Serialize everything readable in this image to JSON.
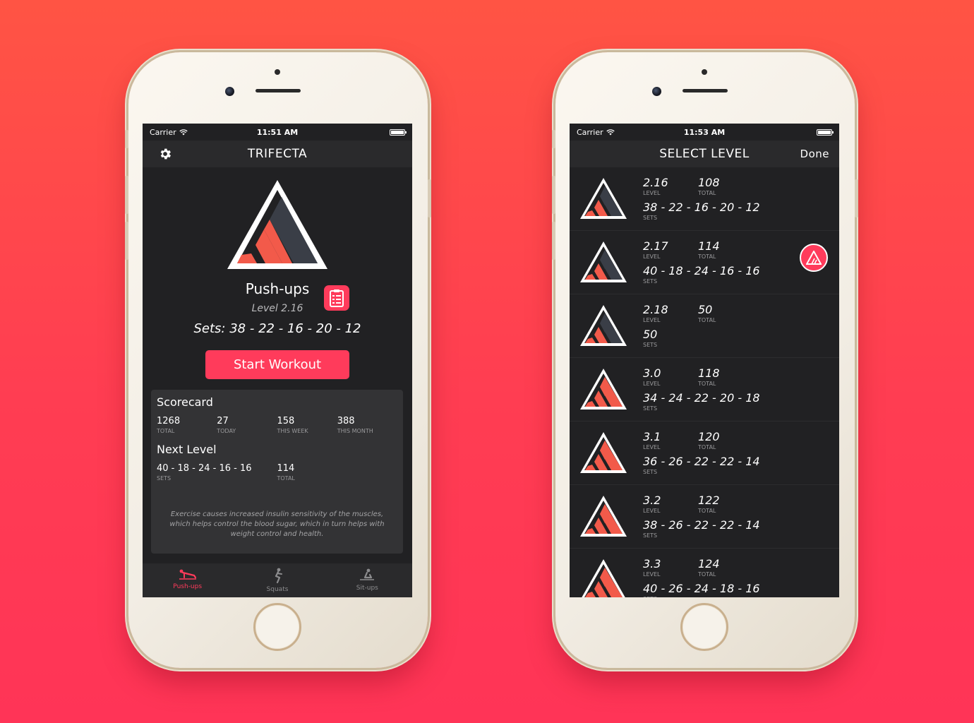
{
  "left": {
    "status": {
      "carrier": "Carrier",
      "time": "11:51 AM"
    },
    "nav": {
      "title": "TRIFECTA"
    },
    "exercise": {
      "name": "Push-ups",
      "level": "Level 2.16",
      "sets": "Sets: 38 - 22 - 16 - 20 - 12",
      "start_label": "Start Workout"
    },
    "scorecard": {
      "title": "Scorecard",
      "stats": [
        {
          "value": "1268",
          "label": "TOTAL"
        },
        {
          "value": "27",
          "label": "TODAY"
        },
        {
          "value": "158",
          "label": "THIS WEEK"
        },
        {
          "value": "388",
          "label": "THIS MONTH"
        }
      ]
    },
    "next_level": {
      "title": "Next Level",
      "sets_value": "40 - 18 - 24 - 16 - 16",
      "sets_label": "SETS",
      "total_value": "114",
      "total_label": "TOTAL"
    },
    "quote": "Exercise causes increased insulin sensitivity of the muscles, which helps control the blood sugar, which in turn helps with weight control and health.",
    "tabs": [
      {
        "label": "Push-ups",
        "icon": "pushup-icon",
        "active": true
      },
      {
        "label": "Squats",
        "icon": "squat-icon",
        "active": false
      },
      {
        "label": "Sit-ups",
        "icon": "situp-icon",
        "active": false
      }
    ]
  },
  "right": {
    "status": {
      "carrier": "Carrier",
      "time": "11:53 AM"
    },
    "nav": {
      "title": "SELECT LEVEL",
      "done_label": "Done"
    },
    "labels": {
      "level": "LEVEL",
      "total": "TOTAL",
      "sets": "SETS"
    },
    "levels": [
      {
        "level": "2.16",
        "total": "108",
        "sets": "38 - 22 - 16 - 20 - 12",
        "current": false
      },
      {
        "level": "2.17",
        "total": "114",
        "sets": "40 - 18 - 24 - 16 - 16",
        "current": true
      },
      {
        "level": "2.18",
        "total": "50",
        "sets": "50",
        "current": false
      },
      {
        "level": "3.0",
        "total": "118",
        "sets": "34 - 24 - 22 - 20 - 18",
        "current": false
      },
      {
        "level": "3.1",
        "total": "120",
        "sets": "36 - 26 - 22 - 22 - 14",
        "current": false
      },
      {
        "level": "3.2",
        "total": "122",
        "sets": "38 - 26 - 22 - 22 - 14",
        "current": false
      },
      {
        "level": "3.3",
        "total": "124",
        "sets": "40 - 26 - 24 - 18 - 16",
        "current": false
      }
    ]
  },
  "colors": {
    "accent": "#ff3b5b",
    "triangle_red": "#f25a4a",
    "triangle_dark": "#3a3e47",
    "screen_bg": "#212123"
  }
}
